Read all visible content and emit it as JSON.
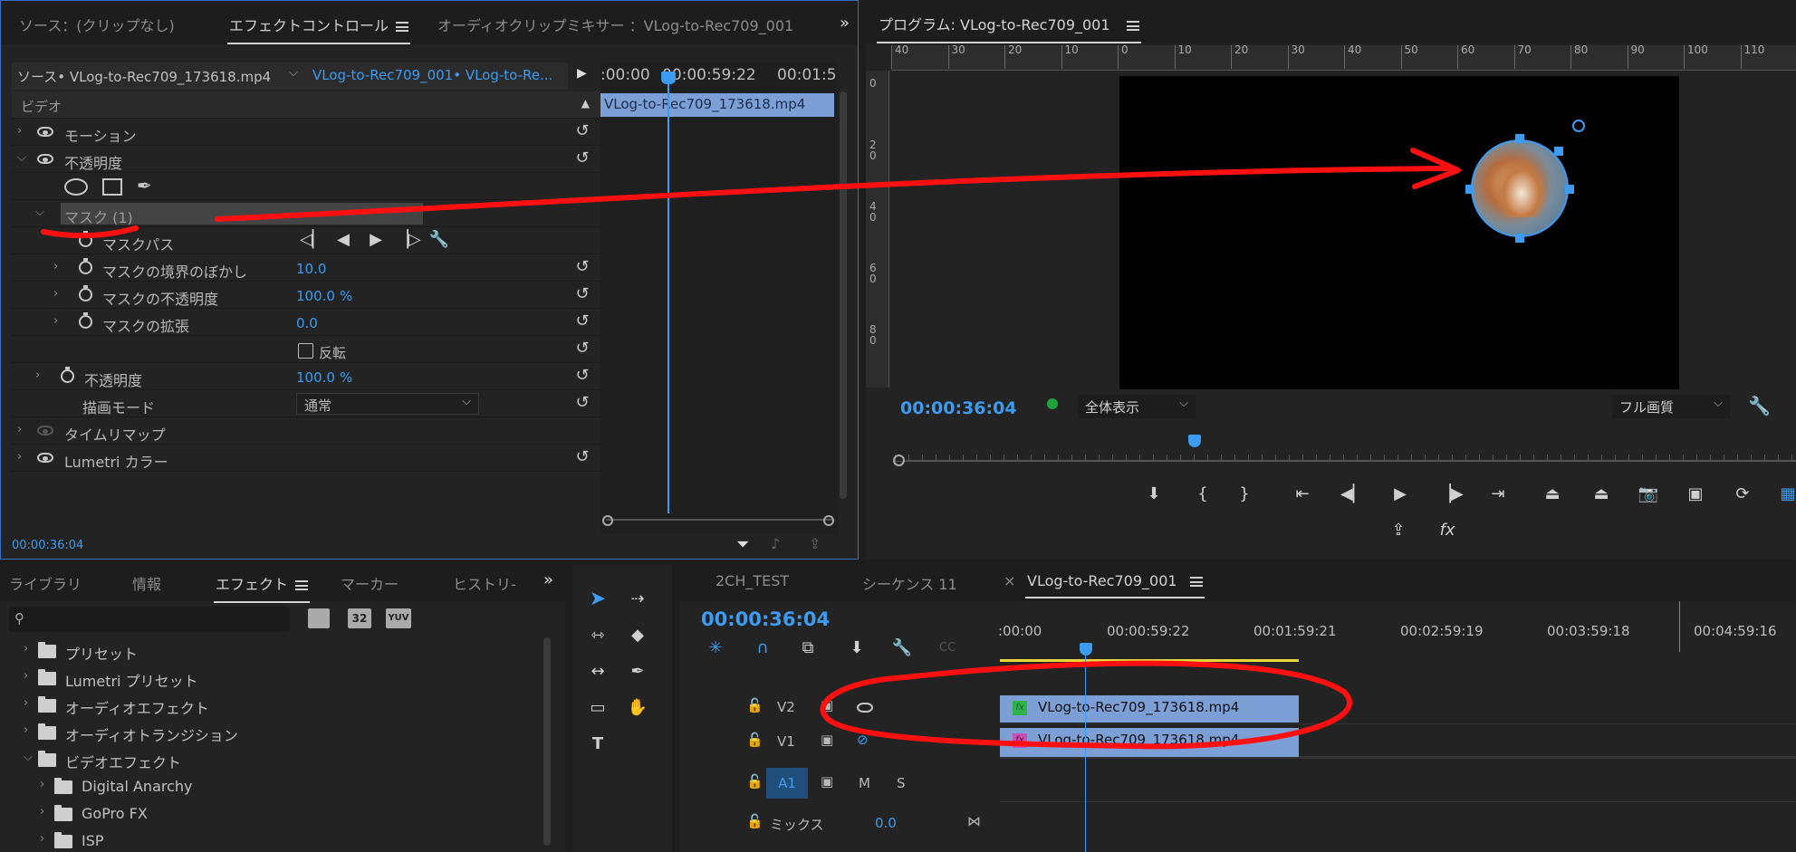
{
  "source_panel": {
    "tabs": [
      "ソース：(クリップなし)",
      "エフェクトコントロール",
      "オーディオクリップミキサー ：VLog-to-Rec709_001"
    ],
    "source_label": "ソース• VLog-to-Rec709_173618.mp4",
    "sequence_label": "VLog-to-Rec709_001• VLog-to-Re...",
    "time_1": ":00:00",
    "time_2": "00:00:59:22",
    "time_3": "00:01:5",
    "clip_name": "VLog-to-Rec709_173618.mp4",
    "section_video": "ビデオ",
    "motion": "モーション",
    "opacity": "不透明度",
    "mask": "マスク (1)",
    "mask_path": "マスクパス",
    "mask_feather": "マスクの境界のぼかし",
    "mask_feather_value": "10.0",
    "mask_opacity": "マスクの不透明度",
    "mask_opacity_value": "100.0",
    "percent": "%",
    "mask_expansion": "マスクの拡張",
    "mask_expansion_value": "0.0",
    "invert": "反転",
    "opacity_param": "不透明度",
    "opacity_value": "100.0",
    "blend_mode": "描画モード",
    "blend_mode_value": "通常",
    "time_remap": "タイムリマップ",
    "lumetri": "Lumetri カラー",
    "bottom_timecode": "00:00:36:04"
  },
  "program_monitor": {
    "title": "プログラム: VLog-to-Rec709_001",
    "timecode": "00:00:36:04",
    "zoom": "全体表示",
    "quality": "フル画質",
    "ruler_top": [
      "40",
      "30",
      "20",
      "10",
      "0",
      "10",
      "20",
      "30",
      "40",
      "50",
      "60",
      "70",
      "80",
      "90",
      "100",
      "110"
    ],
    "ruler_left": [
      "0",
      "2\n0",
      "4\n0",
      "6\n0",
      "8\n0"
    ]
  },
  "effects_panel": {
    "tabs": [
      "ライブラリ",
      "情報",
      "エフェクト",
      "マーカー",
      "ヒストリ-"
    ],
    "search_placeholder": "",
    "badge_32": "32",
    "badge_yuv": "YUV",
    "items": [
      {
        "label": "プリセット",
        "level": 0
      },
      {
        "label": "Lumetri プリセット",
        "level": 0
      },
      {
        "label": "オーディオエフェクト",
        "level": 0
      },
      {
        "label": "オーディオトランジション",
        "level": 0
      },
      {
        "label": "ビデオエフェクト",
        "level": 0,
        "open": true
      },
      {
        "label": "Digital Anarchy",
        "level": 1
      },
      {
        "label": "GoPro FX",
        "level": 1
      },
      {
        "label": "ISP",
        "level": 1
      }
    ]
  },
  "timeline": {
    "tabs": [
      "2CH_TEST",
      "シーケンス 11",
      "VLog-to-Rec709_001"
    ],
    "close": "×",
    "timecode": "00:00:36:04",
    "ruler": [
      ":00:00",
      "00:00:59:22",
      "00:01:59:21",
      "00:02:59:19",
      "00:03:59:18",
      "00:04:59:16"
    ],
    "track_v2": "V2",
    "track_v1": "V1",
    "track_a1": "A1",
    "m": "M",
    "s": "S",
    "mix_label": "ミックス",
    "mix_value": "0.0",
    "clip_v2": "VLog-to-Rec709_173618.mp4",
    "clip_v1": "VLog-to-Rec709_173618.mp4",
    "fx": "fx"
  },
  "colors": {
    "accent": "#3d9bf0",
    "annotation": "#ff1010",
    "clip": "#7c9fd6"
  }
}
